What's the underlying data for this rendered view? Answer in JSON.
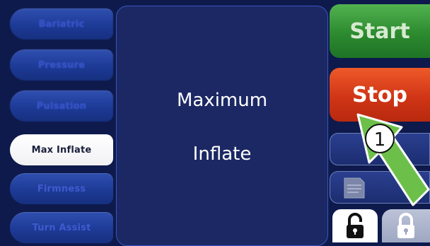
{
  "left_menu": {
    "items": [
      {
        "label": "Bariatric"
      },
      {
        "label": "Pressure"
      },
      {
        "label": "Pulsation"
      },
      {
        "label": "Max Inflate"
      },
      {
        "label": "Firmness"
      },
      {
        "label": "Turn Assist"
      }
    ],
    "selected_index": 3
  },
  "center_panel": {
    "line1": "Maximum",
    "line2": "Inflate"
  },
  "right_controls": {
    "start_label": "Start",
    "stop_label": "Stop"
  },
  "annotation": {
    "number": "1"
  },
  "icons": {
    "unlock": "unlocked-padlock-icon",
    "lock": "locked-padlock-icon",
    "document": "document-icon"
  },
  "colors": {
    "background": "#0e1a4c",
    "panel": "#1b2864",
    "start": "#2c8a2f",
    "stop": "#d03516",
    "callout": "#6cc04a"
  }
}
